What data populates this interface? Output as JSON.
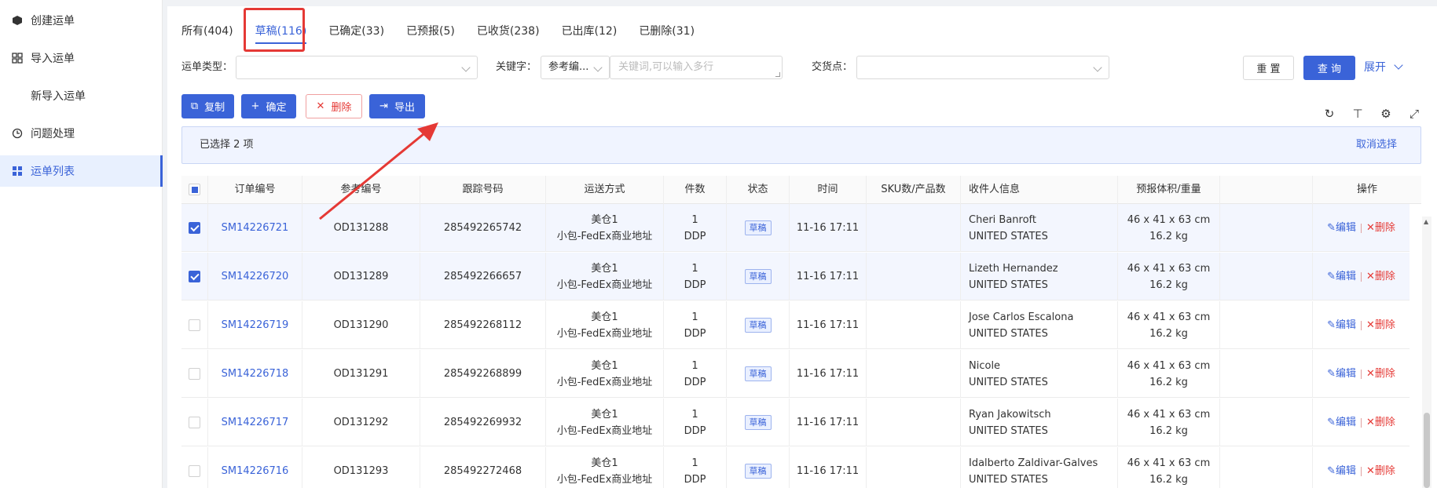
{
  "sidebar": {
    "items": [
      {
        "label": "创建运单",
        "icon": "box-icon"
      },
      {
        "label": "导入运单",
        "icon": "grid-icon"
      },
      {
        "label": "新导入运单",
        "icon": ""
      },
      {
        "label": "问题处理",
        "icon": "clock-icon"
      },
      {
        "label": "运单列表",
        "icon": "list-icon"
      }
    ]
  },
  "tabs": [
    {
      "label": "所有(404)"
    },
    {
      "label": "草稿(116)"
    },
    {
      "label": "已确定(33)"
    },
    {
      "label": "已预报(5)"
    },
    {
      "label": "已收货(238)"
    },
    {
      "label": "已出库(12)"
    },
    {
      "label": "已删除(31)"
    }
  ],
  "filters": {
    "waybill_type_label": "运单类型：",
    "keyword_label": "关键字：",
    "keyword_type_value": "参考编...",
    "keyword_placeholder": "关键词,可以输入多行",
    "delivery_label": "交货点："
  },
  "actions": {
    "reset": "重 置",
    "query": "查 询",
    "expand": "展开",
    "copy": "复制",
    "confirm": "确定",
    "delete": "删除",
    "export": "导出"
  },
  "selection": {
    "text": "已选择 2 项",
    "cancel": "取消选择"
  },
  "table": {
    "headers": [
      "订单编号",
      "参考编号",
      "跟踪号码",
      "运送方式",
      "件数",
      "状态",
      "时间",
      "SKU数/产品数",
      "收件人信息",
      "预报体积/重量",
      "操作"
    ],
    "edit_label": "编辑",
    "delete_label": "删除",
    "rows": [
      {
        "order": "SM14226721",
        "ref": "OD131288",
        "track": "285492265742",
        "ship1": "美仓1",
        "ship2": "小包-FedEx商业地址",
        "qty": "1",
        "term": "DDP",
        "status": "草稿",
        "time": "11-16 17:11",
        "name": "Cheri Banroft",
        "country": "UNITED STATES",
        "dim": "46 x 41 x 63 cm",
        "weight": "16.2 kg",
        "checked": true
      },
      {
        "order": "SM14226720",
        "ref": "OD131289",
        "track": "285492266657",
        "ship1": "美仓1",
        "ship2": "小包-FedEx商业地址",
        "qty": "1",
        "term": "DDP",
        "status": "草稿",
        "time": "11-16 17:11",
        "name": "Lizeth Hernandez",
        "country": "UNITED STATES",
        "dim": "46 x 41 x 63 cm",
        "weight": "16.2 kg",
        "checked": true
      },
      {
        "order": "SM14226719",
        "ref": "OD131290",
        "track": "285492268112",
        "ship1": "美仓1",
        "ship2": "小包-FedEx商业地址",
        "qty": "1",
        "term": "DDP",
        "status": "草稿",
        "time": "11-16 17:11",
        "name": "Jose Carlos Escalona",
        "country": "UNITED STATES",
        "dim": "46 x 41 x 63 cm",
        "weight": "16.2 kg",
        "checked": false
      },
      {
        "order": "SM14226718",
        "ref": "OD131291",
        "track": "285492268899",
        "ship1": "美仓1",
        "ship2": "小包-FedEx商业地址",
        "qty": "1",
        "term": "DDP",
        "status": "草稿",
        "time": "11-16 17:11",
        "name": "Nicole",
        "country": "UNITED STATES",
        "dim": "46 x 41 x 63 cm",
        "weight": "16.2 kg",
        "checked": false
      },
      {
        "order": "SM14226717",
        "ref": "OD131292",
        "track": "285492269932",
        "ship1": "美仓1",
        "ship2": "小包-FedEx商业地址",
        "qty": "1",
        "term": "DDP",
        "status": "草稿",
        "time": "11-16 17:11",
        "name": "Ryan Jakowitsch",
        "country": "UNITED STATES",
        "dim": "46 x 41 x 63 cm",
        "weight": "16.2 kg",
        "checked": false
      },
      {
        "order": "SM14226716",
        "ref": "OD131293",
        "track": "285492272468",
        "ship1": "美仓1",
        "ship2": "小包-FedEx商业地址",
        "qty": "1",
        "term": "DDP",
        "status": "草稿",
        "time": "11-16 17:11",
        "name": "Idalberto Zaldivar-Galves",
        "country": "UNITED STATES",
        "dim": "46 x 41 x 63 cm",
        "weight": "16.2 kg",
        "checked": false
      }
    ]
  },
  "colors": {
    "accent": "#3a63d8",
    "danger": "#e53935",
    "highlight": "#e53935"
  }
}
